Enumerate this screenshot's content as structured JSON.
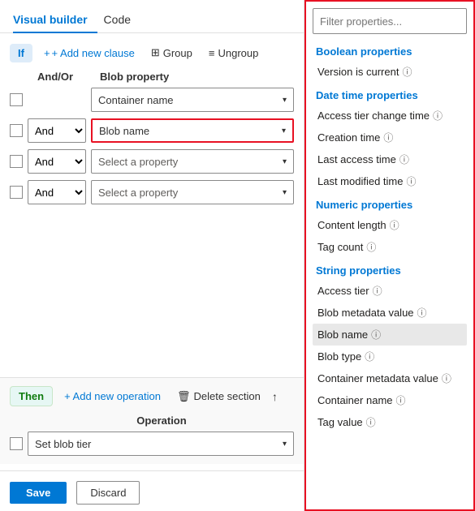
{
  "tabs": [
    {
      "label": "Visual builder",
      "active": true
    },
    {
      "label": "Code",
      "active": false
    }
  ],
  "if_section": {
    "badge": "If",
    "add_clause_label": "+ Add new clause",
    "group_label": "Group",
    "ungroup_label": "Ungroup",
    "columns": {
      "andor": "And/Or",
      "property": "Blob property"
    },
    "rows": [
      {
        "id": 1,
        "andor": null,
        "property": "Container name",
        "placeholder": false,
        "highlighted": false
      },
      {
        "id": 2,
        "andor": "And",
        "property": "Blob name",
        "placeholder": false,
        "highlighted": true
      },
      {
        "id": 3,
        "andor": "And",
        "property": "Select a property",
        "placeholder": true,
        "highlighted": false
      },
      {
        "id": 4,
        "andor": "And",
        "property": "Select a property",
        "placeholder": true,
        "highlighted": false
      }
    ]
  },
  "then_section": {
    "badge": "Then",
    "add_op_label": "+ Add new operation",
    "delete_label": "Delete section",
    "op_column": "Operation",
    "op_value": "Set blob tier"
  },
  "save_bar": {
    "save_label": "Save",
    "discard_label": "Discard"
  },
  "right_panel": {
    "filter_placeholder": "Filter properties...",
    "categories": [
      {
        "label": "Boolean properties",
        "items": [
          {
            "name": "Version is current",
            "info": true
          }
        ]
      },
      {
        "label": "Date time properties",
        "items": [
          {
            "name": "Access tier change time",
            "info": true
          },
          {
            "name": "Creation time",
            "info": true
          },
          {
            "name": "Last access time",
            "info": true
          },
          {
            "name": "Last modified time",
            "info": true
          }
        ]
      },
      {
        "label": "Numeric properties",
        "items": [
          {
            "name": "Content length",
            "info": true
          },
          {
            "name": "Tag count",
            "info": true
          }
        ]
      },
      {
        "label": "String properties",
        "items": [
          {
            "name": "Access tier",
            "info": true
          },
          {
            "name": "Blob metadata value",
            "info": true
          },
          {
            "name": "Blob name",
            "info": true,
            "selected": true
          },
          {
            "name": "Blob type",
            "info": true
          },
          {
            "name": "Container metadata value",
            "info": true
          },
          {
            "name": "Container name",
            "info": true
          },
          {
            "name": "Tag value",
            "info": true
          }
        ]
      }
    ]
  }
}
